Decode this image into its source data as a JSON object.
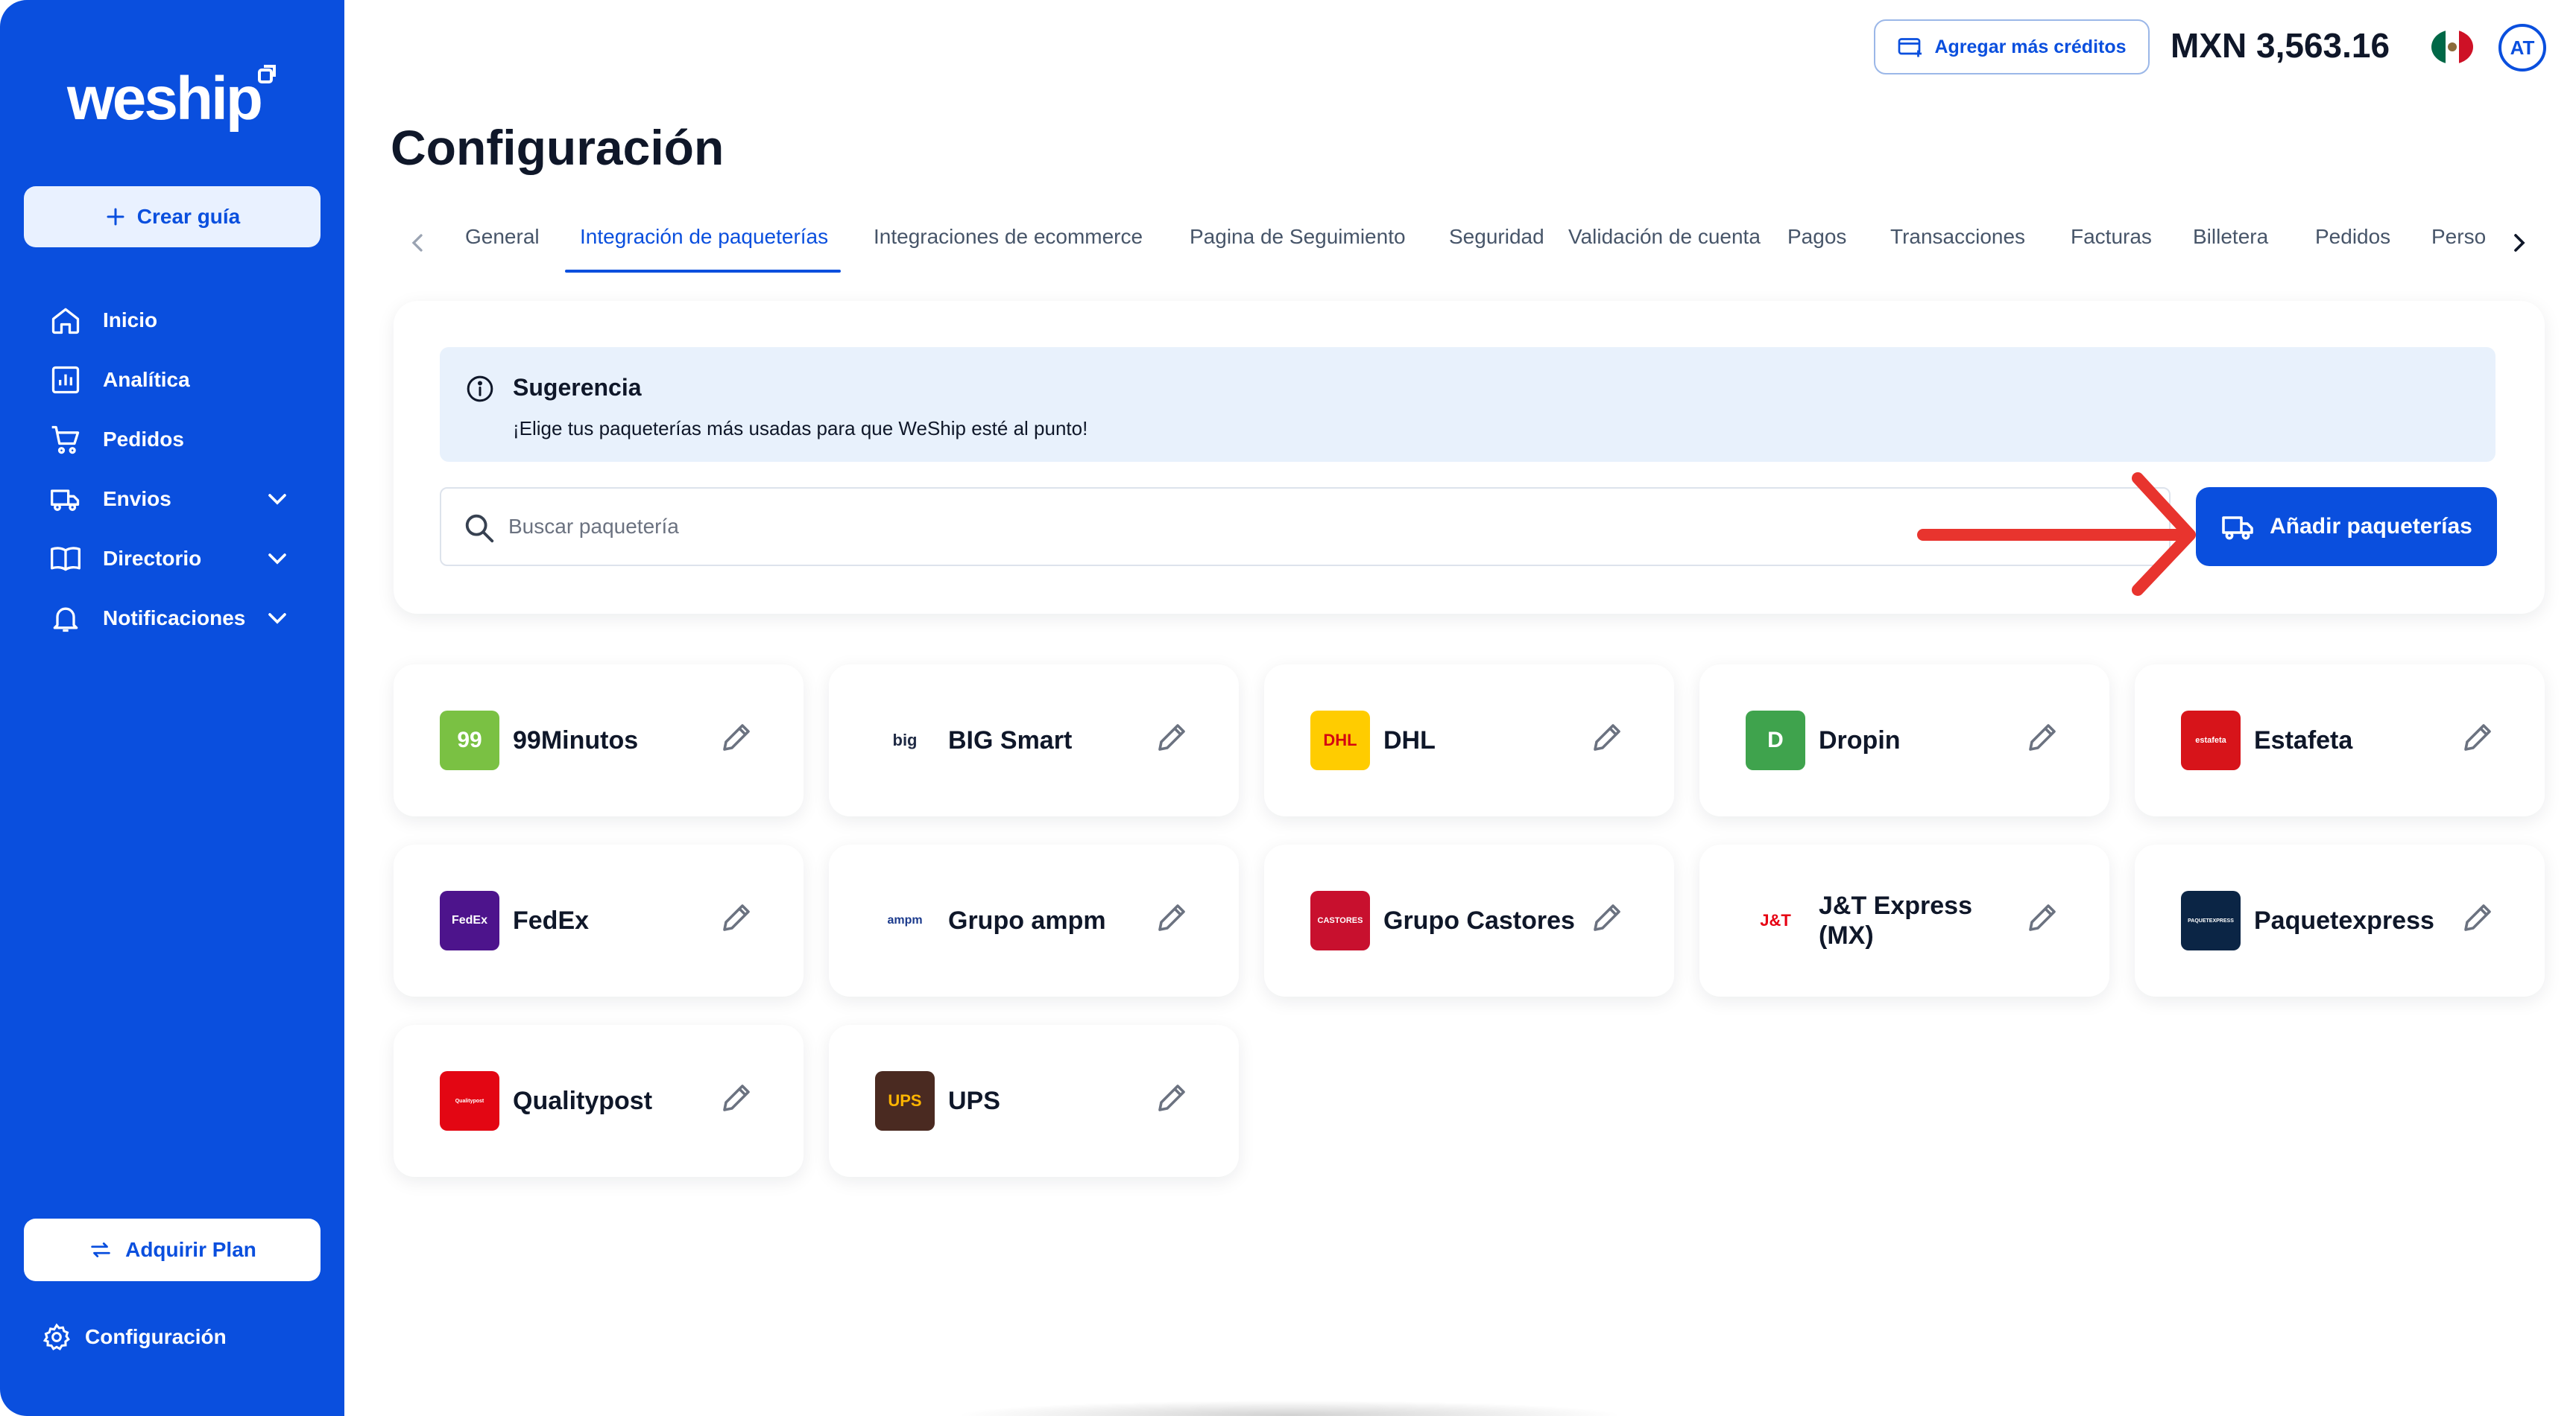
{
  "sidebar": {
    "logo": "weship",
    "create_label": "Crear guía",
    "items": [
      {
        "label": "Inicio",
        "icon": "home-icon"
      },
      {
        "label": "Analítica",
        "icon": "analytics-icon"
      },
      {
        "label": "Pedidos",
        "icon": "cart-icon"
      },
      {
        "label": "Envios",
        "icon": "truck-icon",
        "expandable": true
      },
      {
        "label": "Directorio",
        "icon": "book-icon",
        "expandable": true
      },
      {
        "label": "Notificaciones",
        "icon": "bell-icon",
        "expandable": true
      }
    ],
    "plan_label": "Adquirir Plan",
    "config_label": "Configuración"
  },
  "topbar": {
    "credits_label": "Agregar más créditos",
    "balance": "MXN 3,563.16",
    "avatar_initials": "AT"
  },
  "page": {
    "title": "Configuración"
  },
  "tabs": [
    {
      "label": "General",
      "active": false
    },
    {
      "label": "Integración de paqueterías",
      "active": true
    },
    {
      "label": "Integraciones de ecommerce",
      "active": false
    },
    {
      "label": "Pagina de Seguimiento",
      "active": false
    },
    {
      "label": "Seguridad",
      "active": false
    },
    {
      "label": "Validación de cuenta",
      "active": false
    },
    {
      "label": "Pagos",
      "active": false
    },
    {
      "label": "Transacciones",
      "active": false
    },
    {
      "label": "Facturas",
      "active": false
    },
    {
      "label": "Billetera",
      "active": false
    },
    {
      "label": "Pedidos",
      "active": false
    },
    {
      "label": "Perso",
      "active": false
    }
  ],
  "tip": {
    "title": "Sugerencia",
    "text": "¡Elige tus paqueterías más usadas para que WeShip esté al punto!"
  },
  "search": {
    "placeholder": "Buscar paquetería"
  },
  "add_button_label": "Añadir paqueterías",
  "carriers": [
    {
      "name": "99Minutos",
      "logo_text": "99",
      "logo_bg": "#7ac143",
      "logo_fg": "#ffffff"
    },
    {
      "name": "BIG Smart",
      "logo_text": "big",
      "logo_bg": "#ffffff",
      "logo_fg": "#1f2a44"
    },
    {
      "name": "DHL",
      "logo_text": "DHL",
      "logo_bg": "#ffcc00",
      "logo_fg": "#d40511"
    },
    {
      "name": "Dropin",
      "logo_text": "D",
      "logo_bg": "#3fa34d",
      "logo_fg": "#ffffff"
    },
    {
      "name": "Estafeta",
      "logo_text": "estafeta",
      "logo_bg": "#d7141a",
      "logo_fg": "#ffffff"
    },
    {
      "name": "FedEx",
      "logo_text": "FedEx",
      "logo_bg": "#4d148c",
      "logo_fg": "#ffffff"
    },
    {
      "name": "Grupo ampm",
      "logo_text": "ampm",
      "logo_bg": "#ffffff",
      "logo_fg": "#1b3a8c"
    },
    {
      "name": "Grupo Castores",
      "logo_text": "CASTORES",
      "logo_bg": "#c8102e",
      "logo_fg": "#ffffff"
    },
    {
      "name": "J&T Express (MX)",
      "logo_text": "J&T",
      "logo_bg": "#ffffff",
      "logo_fg": "#e60012"
    },
    {
      "name": "Paquetexpress",
      "logo_text": "PAQUETEXPRESS",
      "logo_bg": "#0b2545",
      "logo_fg": "#ffffff"
    },
    {
      "name": "Qualitypost",
      "logo_text": "Qualitypost",
      "logo_bg": "#e30613",
      "logo_fg": "#ffffff"
    },
    {
      "name": "UPS",
      "logo_text": "UPS",
      "logo_bg": "#4a2a21",
      "logo_fg": "#ffb500"
    }
  ],
  "colors": {
    "brand": "#0a4fde",
    "tip_bg": "#e8f1fc",
    "annotation_arrow": "#e8342e"
  }
}
